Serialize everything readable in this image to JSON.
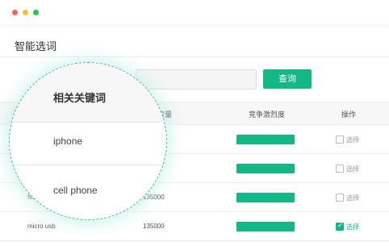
{
  "page": {
    "title": "智能选词"
  },
  "search": {
    "value": "",
    "button_label": "查询"
  },
  "table": {
    "headers": {
      "volume": "索量",
      "competition": "竞争激烈度",
      "action": "操作"
    },
    "rows": [
      {
        "keyword": "",
        "volume": "",
        "competition": 1.0,
        "action_label": "选择",
        "selected": false
      },
      {
        "keyword": "",
        "volume": "",
        "competition": 1.0,
        "action_label": "选择",
        "selected": false
      },
      {
        "keyword": "fla",
        "volume": "135000",
        "competition": 1.0,
        "action_label": "选择",
        "selected": false
      },
      {
        "keyword": "micro usb",
        "volume": "135000",
        "competition": 1.0,
        "action_label": "选择",
        "selected": true
      }
    ]
  },
  "magnifier": {
    "title": "相关关键词",
    "items": [
      "iphone",
      "cell phone"
    ]
  },
  "colors": {
    "accent": "#12b886",
    "magnifier_border": "#3fbf9f"
  },
  "icons": [
    "checkmark-icon"
  ]
}
